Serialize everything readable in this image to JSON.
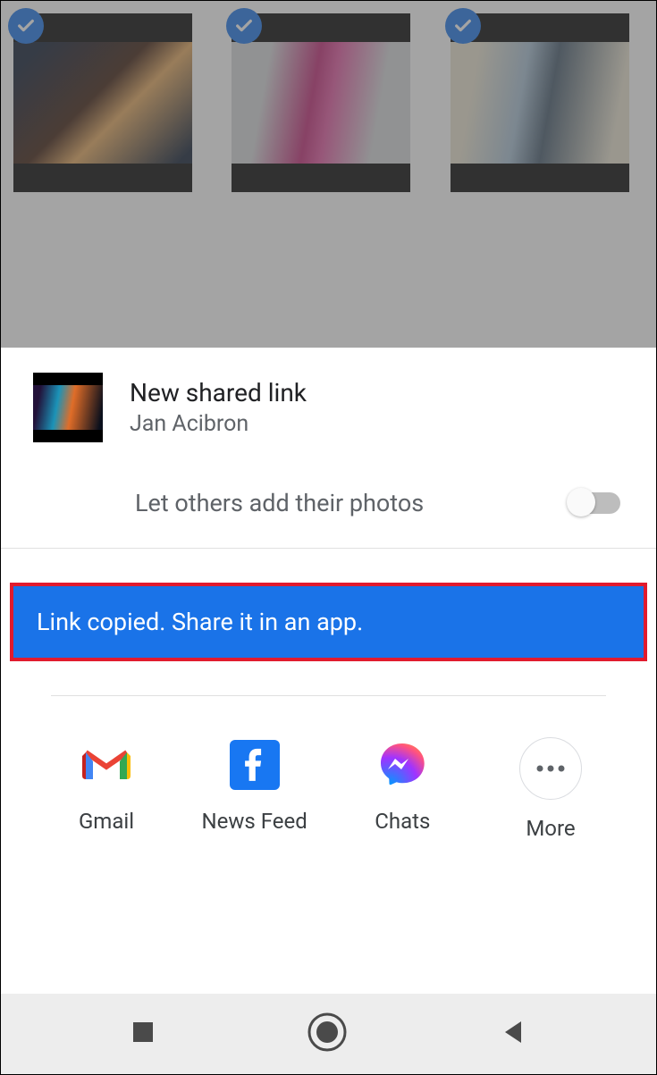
{
  "share_sheet": {
    "title": "New shared link",
    "subtitle": "Jan Acibron",
    "let_others_label": "Let others add their photos",
    "let_others_enabled": false,
    "banner_text": "Link copied. Share it in an app."
  },
  "apps": [
    {
      "label": "Gmail",
      "icon": "gmail-icon"
    },
    {
      "label": "News Feed",
      "icon": "facebook-icon"
    },
    {
      "label": "Chats",
      "icon": "messenger-icon"
    },
    {
      "label": "More",
      "icon": "more-icon"
    }
  ],
  "grid": {
    "items": [
      {
        "selected": true
      },
      {
        "selected": true
      },
      {
        "selected": true
      },
      {
        "selected": true
      },
      {
        "selected": true
      },
      {
        "selected": true
      }
    ]
  },
  "colors": {
    "accent": "#1a73e8",
    "banner_border": "#e11b2e"
  }
}
